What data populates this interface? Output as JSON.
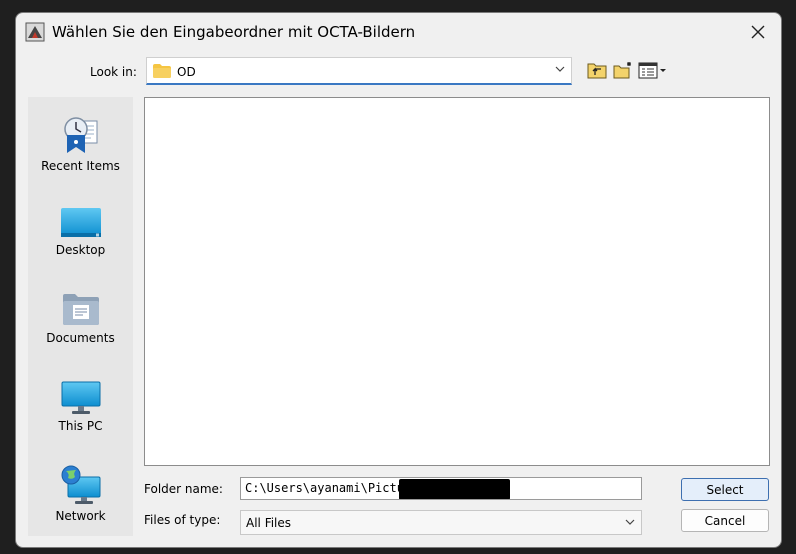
{
  "dialog": {
    "title": "Wählen Sie den Eingabeordner mit OCTA-Bildern",
    "close_icon": "close-icon"
  },
  "lookin": {
    "label": "Look in:",
    "value": "OD"
  },
  "toolbar": {
    "icons": [
      "up-one-level-icon",
      "create-new-folder-icon",
      "view-menu-icon"
    ]
  },
  "places": [
    {
      "label": "Recent Items",
      "icon": "recent-items-icon"
    },
    {
      "label": "Desktop",
      "icon": "desktop-icon"
    },
    {
      "label": "Documents",
      "icon": "documents-icon"
    },
    {
      "label": "This PC",
      "icon": "this-pc-icon"
    },
    {
      "label": "Network",
      "icon": "network-icon"
    }
  ],
  "folder_name": {
    "label": "Folder name:",
    "value": "C:\\Users\\ayanami\\Pictures"
  },
  "files_of_type": {
    "label": "Files of type:",
    "value": "All Files"
  },
  "buttons": {
    "select": "Select",
    "cancel": "Cancel"
  },
  "colors": {
    "accent": "#3a78c3",
    "folder": "#f5c542"
  }
}
